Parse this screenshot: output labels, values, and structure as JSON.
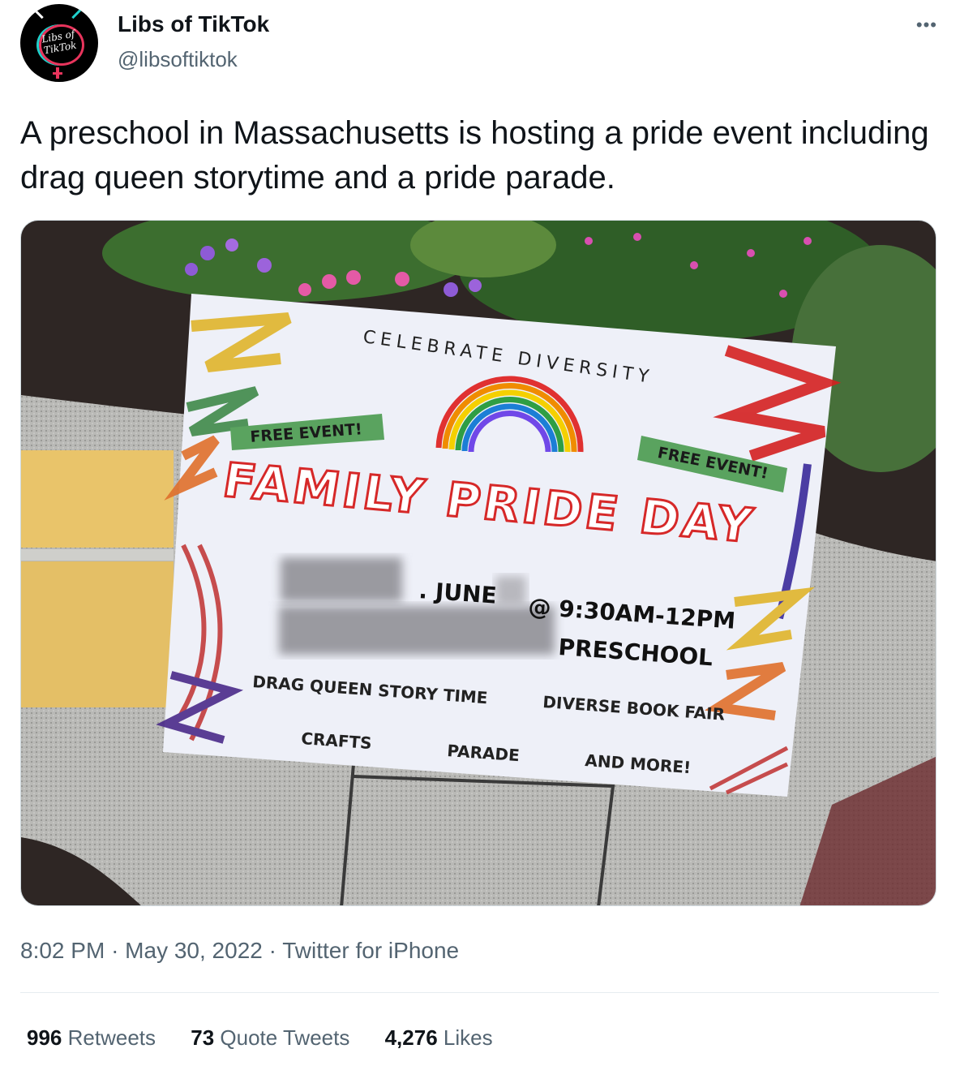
{
  "author": {
    "display_name": "Libs of TikTok",
    "handle": "@libsoftiktok",
    "avatar_text_1": "Libs of",
    "avatar_text_2": "TikTok"
  },
  "more_icon": "•••",
  "tweet_text": "A preschool in Massachusetts is hosting a pride event including drag queen storytime and a pride parade.",
  "sign": {
    "arc_text": "CELEBRATE DIVERSITY",
    "free_left": "FREE EVENT!",
    "free_right": "FREE EVENT!",
    "headline": "FAMILY PRIDE DAY",
    "date_line": ". JUNE",
    "time_line": "@ 9:30AM-12PM",
    "location_line": "PRESCHOOL",
    "item_drag": "DRAG QUEEN STORY TIME",
    "item_book": "DIVERSE BOOK FAIR",
    "item_crafts": "CRAFTS",
    "item_parade": "PARADE",
    "item_more": "AND MORE!"
  },
  "meta": {
    "time": "8:02 PM",
    "sep1": "·",
    "date": "May 30, 2022",
    "sep2": "·",
    "source": "Twitter for iPhone"
  },
  "stats": {
    "retweets_count": "996",
    "retweets_label": "Retweets",
    "quotes_count": "73",
    "quotes_label": "Quote Tweets",
    "likes_count": "4,276",
    "likes_label": "Likes"
  },
  "colors": {
    "sign_bg": "#eef0f8",
    "headline_red": "#d62828",
    "badge_green": "#3f8a4a",
    "pavement": "#b9b9b6",
    "mulch": "#2e2624",
    "tactile_yellow": "#e9c46a"
  }
}
